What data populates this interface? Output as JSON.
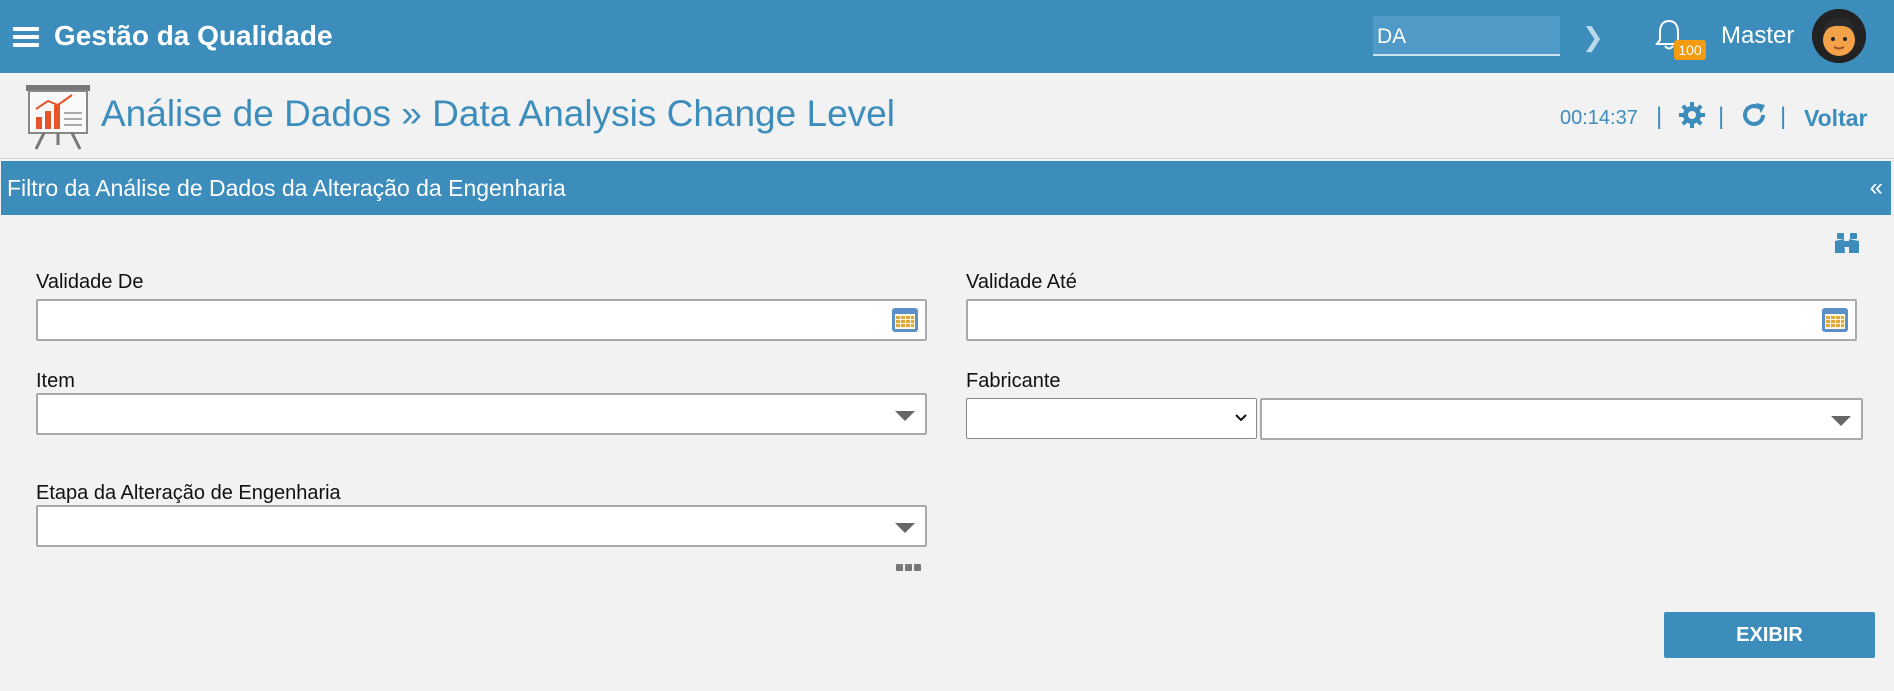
{
  "topbar": {
    "app_title": "Gestão da Qualidade",
    "search_value": "DA",
    "notification_count": "100",
    "user_name": "Master"
  },
  "page": {
    "title": "Análise de Dados » Data Analysis Change Level",
    "timer": "00:14:37",
    "separator": "|",
    "back_label": "Voltar"
  },
  "panel": {
    "title": "Filtro da Análise de Dados da Alteração da Engenharia",
    "collapse_glyph": "«"
  },
  "form": {
    "validade_de_label": "Validade De",
    "validade_ate_label": "Validade Até",
    "item_label": "Item",
    "fabricante_label": "Fabricante",
    "etapa_label": "Etapa da Alteração de Engenharia",
    "submit_label": "EXIBIR"
  },
  "colors": {
    "primary": "#3c8dbc",
    "badge": "#f39c12",
    "background": "#f2f2f2"
  }
}
